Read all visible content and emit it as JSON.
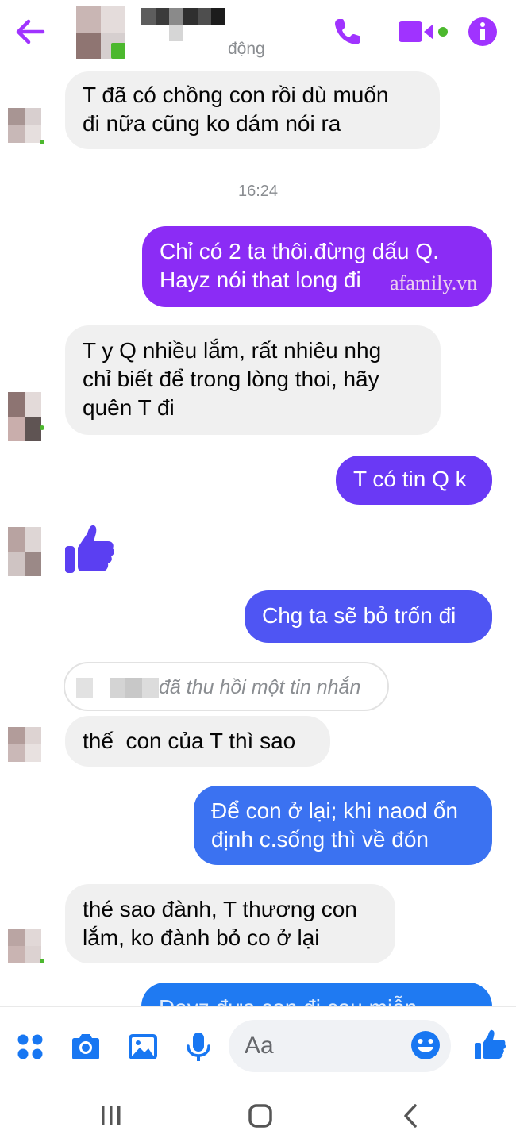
{
  "colors": {
    "accent": "#a033ff",
    "bubble_purple": "#8b2cf5",
    "bubble_violet": "#6a39f5",
    "bubble_blue": "#3b72f1",
    "bubble_blue2": "#1f7af2",
    "incoming_bg": "#f0f0f0",
    "online": "#4cb82e",
    "composer_icon": "#1877f2"
  },
  "header": {
    "status": "động",
    "icons": [
      "back-arrow-icon",
      "phone-icon",
      "video-camera-icon",
      "info-icon"
    ]
  },
  "messages": [
    {
      "dir": "in",
      "lines": [
        "T đã có chồng con rồi dù muốn",
        "đi nữa cũng ko dám nói ra"
      ]
    },
    {
      "timestamp": "16:24"
    },
    {
      "dir": "out",
      "lines": [
        "Chỉ có 2 ta thôi.đừng dấu Q.",
        "Hayz nói that long đi"
      ],
      "watermark": "afamily.vn"
    },
    {
      "dir": "in",
      "lines": [
        "T y Q nhiều lắm, rất nhiêu nhg",
        "chỉ biết để trong lòng thoi, hãy",
        "quên T đi"
      ]
    },
    {
      "dir": "out",
      "lines": [
        "T có tin Q k"
      ]
    },
    {
      "dir": "in",
      "type": "like",
      "icon": "thumbs-up-icon"
    },
    {
      "dir": "out",
      "lines": [
        "Chg ta sẽ bỏ trốn đi"
      ]
    },
    {
      "type": "recalled",
      "text": "đã thu hồi một tin nhắn"
    },
    {
      "dir": "in",
      "lines": [
        "thế  con của T thì sao"
      ]
    },
    {
      "dir": "out",
      "lines": [
        "Để con ở lại; khi naod ổn",
        "định c.sống thì về đón"
      ]
    },
    {
      "dir": "in",
      "lines": [
        "thé sao đành, T thương con",
        "lắm, ko đành bỏ co ở lại"
      ]
    },
    {
      "dir": "out",
      "lines": [
        "Dayz đưa con đi cau miễn"
      ],
      "partial": true
    }
  ],
  "composer": {
    "placeholder": "Aa",
    "icons": [
      "apps-dots-icon",
      "camera-icon",
      "image-icon",
      "microphone-icon",
      "emoji-icon",
      "thumbs-up-icon"
    ]
  },
  "system_nav": {
    "icons": [
      "recent-apps-icon",
      "home-icon",
      "back-icon"
    ]
  }
}
